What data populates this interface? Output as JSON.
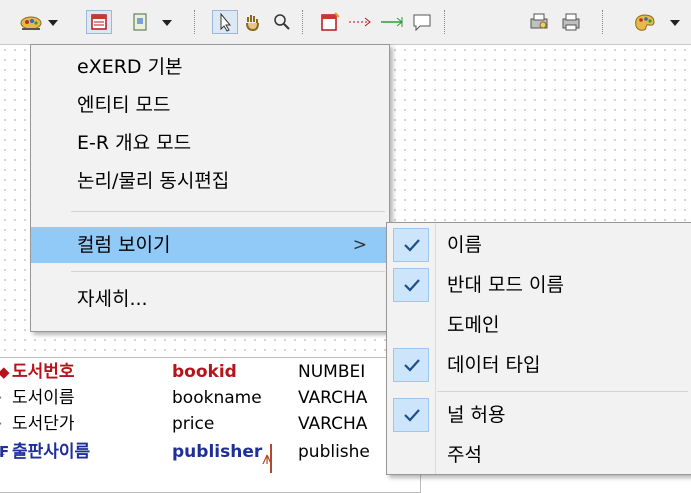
{
  "menu": {
    "items": [
      {
        "label": "eXERD 기본"
      },
      {
        "label": "엔티티 모드"
      },
      {
        "label": "E-R 개요 모드"
      },
      {
        "label": "논리/물리 동시편집"
      },
      {
        "label": "컬럼 보이기",
        "arrow": ">"
      },
      {
        "label": "자세히..."
      }
    ]
  },
  "submenu": {
    "items": [
      {
        "label": "이름",
        "checked": true
      },
      {
        "label": "반대 모드 이름",
        "checked": true
      },
      {
        "label": "도메인",
        "checked": false
      },
      {
        "label": "데이터 타입",
        "checked": true
      },
      {
        "label": "널 허용",
        "checked": true
      },
      {
        "label": "주석",
        "checked": false
      }
    ]
  },
  "entity": {
    "rows": [
      {
        "logical": "도서번호",
        "physical": "bookid",
        "type": "NUMBEI",
        "key": "pk"
      },
      {
        "logical": "도서이름",
        "physical": "bookname",
        "type": "VARCHA",
        "key": "normal"
      },
      {
        "logical": "도서단가",
        "physical": "price",
        "type": "VARCHA",
        "key": "normal"
      },
      {
        "logical": "출판사이름",
        "physical": "publisher",
        "type": "publishe",
        "key": "fk"
      }
    ]
  },
  "toolbar": {
    "icons": [
      "palette-icon",
      "dropdown-arrow-icon",
      "table-view-icon",
      "notes-icon",
      "dropdown-arrow-icon",
      "select-pointer-icon",
      "hand-icon",
      "zoom-icon",
      "new-table-icon",
      "relationship-icon",
      "identifying-relationship-icon",
      "note-icon",
      "print-preview-icon",
      "print-icon",
      "theme-icon",
      "dropdown-arrow-icon"
    ]
  },
  "colors": {
    "highlight": "#91c9f7",
    "check_box": "#cde5fa",
    "pk_text": "#b5141b",
    "fk_text": "#1f2f9a"
  }
}
